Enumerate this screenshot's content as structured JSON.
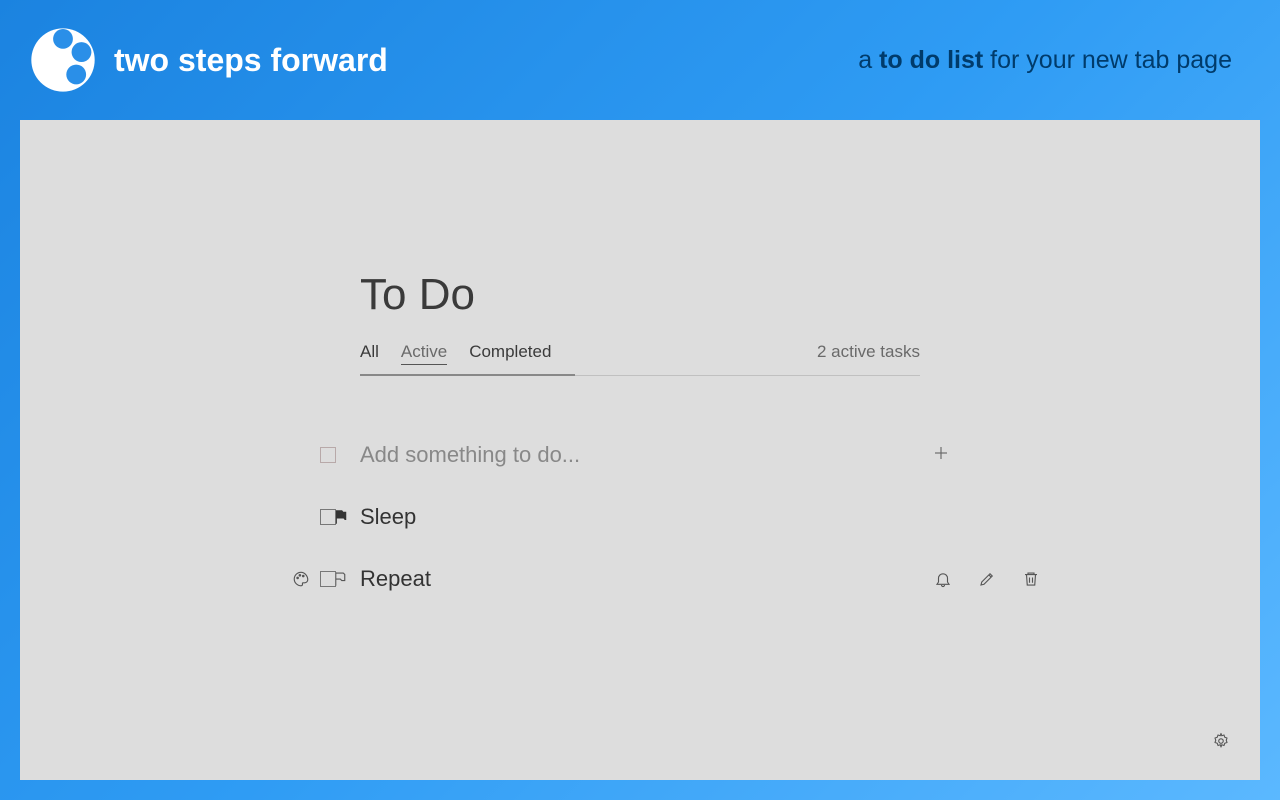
{
  "header": {
    "brand": "two steps forward",
    "tagline_prefix": "a ",
    "tagline_bold": "to do list",
    "tagline_suffix": " for your new tab page"
  },
  "main": {
    "title": "To Do",
    "tabs": {
      "all": "All",
      "active": "Active",
      "completed": "Completed"
    },
    "active_tab": "Active",
    "count_text": "2 active tasks",
    "input_placeholder": "Add something to do...",
    "tasks": [
      {
        "label": "Sleep",
        "flagged": true
      },
      {
        "label": "Repeat",
        "flagged": false
      }
    ]
  },
  "icons": {
    "flag_filled": "flag-filled-icon",
    "flag_outline": "flag-outline-icon",
    "palette": "palette-icon",
    "plus": "plus-icon",
    "bell": "bell-icon",
    "edit": "edit-icon",
    "trash": "trash-icon",
    "gear": "gear-icon"
  }
}
